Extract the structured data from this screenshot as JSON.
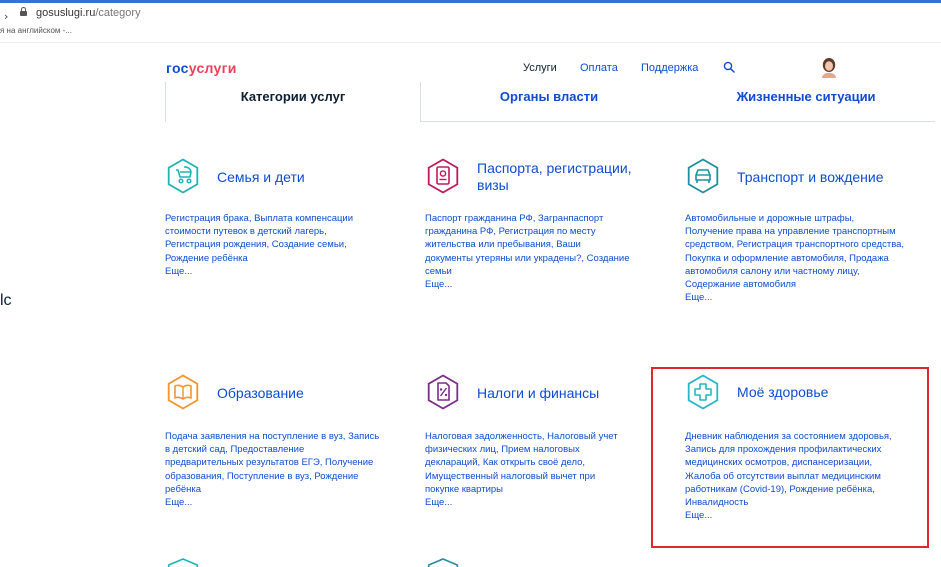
{
  "browser": {
    "forward_glyph": "›",
    "url_host": "gosuslugi.ru",
    "url_path": "/category",
    "bookmark_text": "я на английском -..."
  },
  "side_fragment": "lс",
  "header": {
    "logo_part1": "гос",
    "logo_part2": "услуги",
    "nav": [
      "Услуги",
      "Оплата",
      "Поддержка"
    ]
  },
  "tabs": [
    "Категории услуг",
    "Органы власти",
    "Жизненные ситуации"
  ],
  "categories": [
    {
      "title": "Семья и дети",
      "desc": "Регистрация брака, Выплата компенсации стоимости путевок в детский лагерь, Регистрация рождения, Создание семьи, Рождение ребёнка",
      "more": "Еще..."
    },
    {
      "title": "Паспорта, регистрации, визы",
      "desc": "Паспорт гражданина РФ, Загранпаспорт гражданина РФ, Регистрация по месту жительства или пребывания, Ваши документы утеряны или украдены?, Создание семьи",
      "more": "Еще..."
    },
    {
      "title": "Транспорт и вождение",
      "desc": "Автомобильные и дорожные штрафы, Получение права на управление транспортным средством, Регистрация транспортного средства, Покупка и оформление автомобиля, Продажа автомобиля салону или частному лицу, Содержание автомобиля",
      "more": "Еще..."
    },
    {
      "title": "Образование",
      "desc": "Подача заявления на поступление в вуз, Запись в детский сад, Предоставление предварительных результатов ЕГЭ, Получение образования, Поступление в вуз, Рождение ребёнка",
      "more": "Еще..."
    },
    {
      "title": "Налоги и финансы",
      "desc": "Налоговая задолженность, Налоговый учет физических лиц, Прием налоговых деклараций, Как открыть своё дело, Имущественный налоговый вычет при покупке квартиры",
      "more": "Еще..."
    },
    {
      "title": "Моё здоровье",
      "desc": "Дневник наблюдения за состоянием здоровья, Запись для прохождения профилактических медицинских осмотров, диспансеризации, Жалоба об отсутствии выплат медицинским работникам (Covid-19), Рождение ребёнка, Инвалидность",
      "more": "Еще..."
    }
  ],
  "colors": {
    "family": "#1fb3b6",
    "passport": "#c2185b",
    "transport": "#1e8fa3",
    "education": "#f5942e",
    "taxes": "#7b2d8b",
    "health": "#27b6c8",
    "highlight": "#e0262e"
  },
  "icons": [
    "stroller-icon",
    "passport-icon",
    "car-icon",
    "book-icon",
    "tax-document-icon",
    "medical-cross-icon"
  ]
}
